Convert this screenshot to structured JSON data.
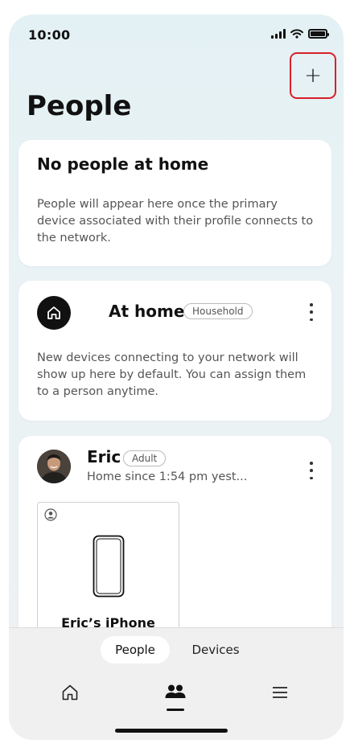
{
  "status_bar": {
    "time": "10:00"
  },
  "header": {
    "title": "People",
    "add_button_label": "+"
  },
  "empty_card": {
    "heading": "No people at home",
    "text": "People will appear here once the primary device associated with their profile connects to the network."
  },
  "home_card": {
    "title": "At home",
    "badge": "Household",
    "text": "New devices connecting to your network will show up here by default. You can assign them to a person anytime.",
    "icon": "home-icon"
  },
  "person_card": {
    "name": "Eric",
    "badge": "Adult",
    "status": "Home since 1:54 pm yest...",
    "devices": [
      {
        "name": "Eric’s iPhone",
        "icon": "smartphone-icon"
      }
    ]
  },
  "segments": {
    "people": "People",
    "devices": "Devices",
    "selected": "People"
  },
  "bottom_nav": {
    "items": [
      {
        "name": "home",
        "icon": "home-icon"
      },
      {
        "name": "people",
        "icon": "people-icon",
        "active": true
      },
      {
        "name": "menu",
        "icon": "menu-icon"
      }
    ]
  },
  "colors": {
    "highlight": "#d9202a",
    "background": "#e4f1f4",
    "card": "#ffffff"
  }
}
